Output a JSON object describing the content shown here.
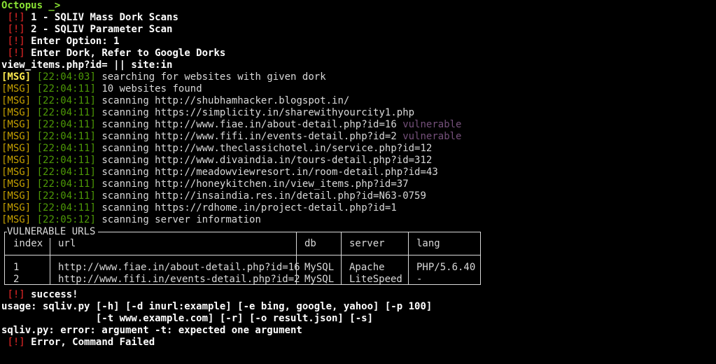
{
  "terminal": {
    "prompt": "Octopus _>",
    "menu": [
      {
        "tag": "[!]",
        "text": "1 - SQLIV Mass Dork Scans"
      },
      {
        "tag": "[!]",
        "text": "2 - SQLIV Parameter Scan"
      },
      {
        "tag": "[!]",
        "text": "Enter Option: 1"
      },
      {
        "tag": "[!]",
        "text": "Enter Dork, Refer to Google Dorks"
      }
    ],
    "dork_input": "view_items.php?id= || site:in",
    "log": [
      {
        "tag": "[MSG]",
        "time": "[22:04:03]",
        "text": "searching for websites with given dork",
        "flag": ""
      },
      {
        "tag": "[MSG]",
        "time": "[22:04:11]",
        "text": "10 websites found",
        "flag": ""
      },
      {
        "tag": "[MSG]",
        "time": "[22:04:11]",
        "text": "scanning http://shubhamhacker.blogspot.in/",
        "flag": ""
      },
      {
        "tag": "[MSG]",
        "time": "[22:04:11]",
        "text": "scanning https://simplicity.in/sharewithyourcity1.php",
        "flag": ""
      },
      {
        "tag": "[MSG]",
        "time": "[22:04:11]",
        "text": "scanning http://www.fiae.in/about-detail.php?id=16",
        "flag": "vulnerable"
      },
      {
        "tag": "[MSG]",
        "time": "[22:04:11]",
        "text": "scanning http://www.fifi.in/events-detail.php?id=2",
        "flag": "vulnerable"
      },
      {
        "tag": "[MSG]",
        "time": "[22:04:11]",
        "text": "scanning http://www.theclassichotel.in/service.php?id=12",
        "flag": ""
      },
      {
        "tag": "[MSG]",
        "time": "[22:04:11]",
        "text": "scanning http://www.divaindia.in/tours-detail.php?id=312",
        "flag": ""
      },
      {
        "tag": "[MSG]",
        "time": "[22:04:11]",
        "text": "scanning http://meadowviewresort.in/room-detail.php?id=43",
        "flag": ""
      },
      {
        "tag": "[MSG]",
        "time": "[22:04:11]",
        "text": "scanning http://honeykitchen.in/view_items.php?id=37",
        "flag": ""
      },
      {
        "tag": "[MSG]",
        "time": "[22:04:11]",
        "text": "scanning http://insaindia.res.in/detail.php?id=N63-0759",
        "flag": ""
      },
      {
        "tag": "[MSG]",
        "time": "[22:04:11]",
        "text": "scanning https://rdhome.in/project-detail.php?id=1",
        "flag": ""
      },
      {
        "tag": "[MSG]",
        "time": "[22:05:12]",
        "text": "scanning server information",
        "flag": ""
      }
    ],
    "table": {
      "title": "VULNERABLE URLS",
      "headers": [
        "index",
        "url",
        "db",
        "server",
        "lang"
      ],
      "rows": [
        [
          "1",
          "http://www.fiae.in/about-detail.php?id=16",
          "MySQL",
          "Apache",
          "PHP/5.6.40"
        ],
        [
          "2",
          "http://www.fifi.in/events-detail.php?id=2",
          "MySQL",
          "LiteSpeed",
          "-"
        ]
      ]
    },
    "success": {
      "tag": "[!]",
      "text": "success!"
    },
    "usage_1": "usage: sqliv.py [-h] [-d inurl:example] [-e bing, google, yahoo] [-p 100]",
    "usage_2": "                [-t www.example.com] [-r] [-o result.json] [-s]",
    "error_line": "sqliv.py: error: argument -t: expected one argument",
    "final": {
      "tag": "[!]",
      "text": "Error, Command Failed"
    },
    "colors": {
      "background": "#000000",
      "prompt": "#8ae234",
      "tag_bang": "#ef2929",
      "msg_first": "#fce94f",
      "msg": "#c4a000",
      "timestamp": "#4e9a06",
      "vulnerable": "#75507b",
      "text": "#d9d9d9"
    }
  }
}
